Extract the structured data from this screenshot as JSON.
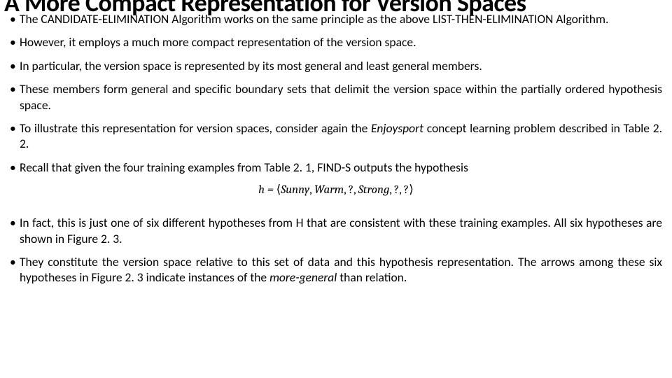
{
  "title": "A More Compact Representation for Version Spaces",
  "bullets": {
    "b1": "The CANDIDATE-ELIMINATION Algorithm works on the same principle as the above LIST-THEN-ELIMINATION Algorithm.",
    "b2": "However, it employs a much more compact representation of the version space.",
    "b3": "In particular, the version space is represented by its most general and least general members.",
    "b4": "These members form general and specific boundary sets that delimit the version space within the partially ordered hypothesis space.",
    "b5_pre": "To illustrate this representation for version spaces, consider again the ",
    "b5_em": "Enjoysport",
    "b5_post": " concept learning problem described in Table 2. 2.",
    "b6": "Recall that given the four training examples from Table 2. 1, FIND-S outputs the hypothesis",
    "b7": "In fact, this is just one of six different hypotheses from H that are consistent with these training examples. All six hypotheses are shown in Figure 2. 3.",
    "b8_pre": "They constitute the version space relative to this set of data and this hypothesis representation. The arrows among these six hypotheses in Figure 2. 3 indicate instances of the ",
    "b8_em": "more-general",
    "b8_post": " than relation."
  },
  "formula": {
    "lhs": "h = ",
    "open": "⟨",
    "t1": "Sunny",
    "t2": "Warm",
    "t3": "?",
    "t4": "Strong",
    "t5": "?",
    "t6": "?",
    "close": "⟩",
    "sep": ", "
  }
}
